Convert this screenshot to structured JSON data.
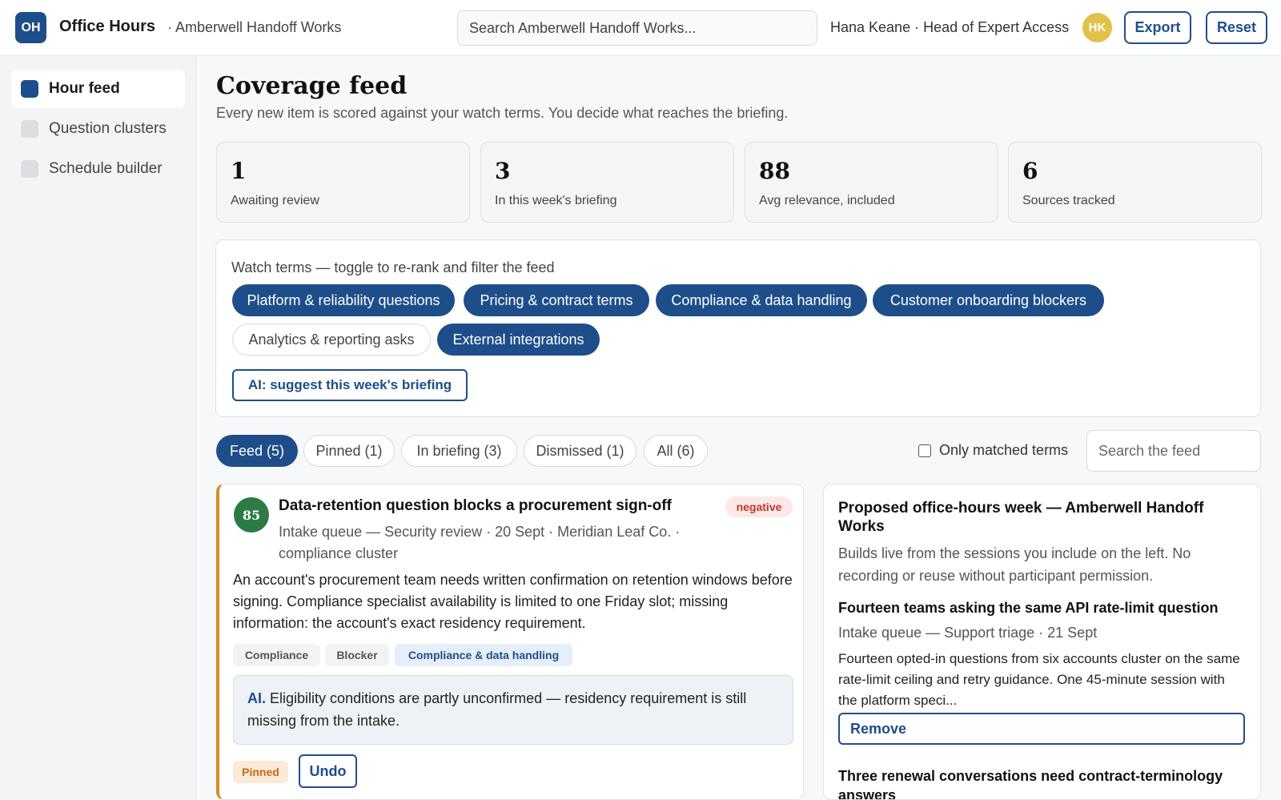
{
  "header": {
    "logo": "OH",
    "app_name": "Office Hours",
    "org": "· Amberwell Handoff Works",
    "search_placeholder": "Search Amberwell Handoff Works...",
    "user": "Hana Keane · Head of Expert Access",
    "avatar": "HK",
    "export_label": "Export",
    "reset_label": "Reset"
  },
  "sidebar": {
    "items": [
      {
        "label": "Hour feed",
        "active": true
      },
      {
        "label": "Question clusters",
        "active": false
      },
      {
        "label": "Schedule builder",
        "active": false
      }
    ]
  },
  "page": {
    "title": "Coverage feed",
    "subtitle": "Every new item is scored against your watch terms. You decide what reaches the briefing."
  },
  "stats": [
    {
      "value": "1",
      "label": "Awaiting review"
    },
    {
      "value": "3",
      "label": "In this week's briefing"
    },
    {
      "value": "88",
      "label": "Avg relevance, included"
    },
    {
      "value": "6",
      "label": "Sources tracked"
    }
  ],
  "watch": {
    "title": "Watch terms — toggle to re-rank and filter the feed",
    "terms": [
      {
        "label": "Platform & reliability questions",
        "on": true
      },
      {
        "label": "Pricing & contract terms",
        "on": true
      },
      {
        "label": "Compliance & data handling",
        "on": true
      },
      {
        "label": "Customer onboarding blockers",
        "on": true
      },
      {
        "label": "Analytics & reporting asks",
        "on": false
      },
      {
        "label": "External integrations",
        "on": true
      }
    ],
    "ai_button": "AI: suggest this week's briefing"
  },
  "tabs": [
    {
      "label": "Feed (5)",
      "active": true
    },
    {
      "label": "Pinned (1)",
      "active": false
    },
    {
      "label": "In briefing (3)",
      "active": false
    },
    {
      "label": "Dismissed (1)",
      "active": false
    },
    {
      "label": "All (6)",
      "active": false
    }
  ],
  "filter": {
    "only_matched_label": "Only matched terms",
    "only_matched_checked": false,
    "search_placeholder": "Search the feed"
  },
  "feed_item": {
    "score": "85",
    "title": "Data-retention question blocks a procurement sign-off",
    "sentiment": "negative",
    "meta": "Intake queue — Security review · 20 Sept · Meridian Leaf Co. · compliance cluster",
    "body": "An account's procurement team needs written confirmation on retention windows before signing. Compliance specialist availability is limited to one Friday slot; missing information: the account's exact residency requirement.",
    "tags": [
      "Compliance",
      "Blocker",
      "Compliance & data handling"
    ],
    "ai_prefix": "AI.",
    "ai_note": "Eligibility conditions are partly unconfirmed — residency requirement is still missing from the intake.",
    "status": "Pinned",
    "undo_label": "Undo"
  },
  "briefing": {
    "title": "Proposed office-hours week — Amberwell Handoff Works",
    "subtitle": "Builds live from the sessions you include on the left. No recording or reuse without participant permission.",
    "items": [
      {
        "title": "Fourteen teams asking the same API rate-limit question",
        "meta": "Intake queue — Support triage · 21 Sept",
        "body": "Fourteen opted-in questions from six accounts cluster on the same rate-limit ceiling and retry guidance. One 45-minute session with the platform speci...",
        "remove_label": "Remove"
      },
      {
        "title": "Three renewal conversations need contract-terminology answers"
      }
    ]
  },
  "colors": {
    "accent": "#1e4e8a",
    "score_green": "#2c7a45",
    "pinned_orange": "#d98a2b",
    "negative_red": "#c0392b",
    "avatar_gold": "#e0c24a"
  }
}
